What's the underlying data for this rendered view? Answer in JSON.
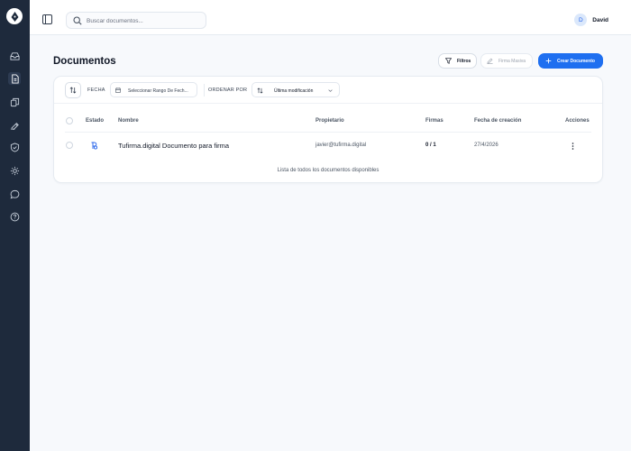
{
  "search": {
    "placeholder": "Buscar documentos..."
  },
  "user": {
    "initial": "D",
    "name": "David"
  },
  "page": {
    "title": "Documentos"
  },
  "actions": {
    "filters": "Filtros",
    "mass_sign": "Firma Masiva",
    "create": "Crear Documento"
  },
  "filters": {
    "date_label": "FECHA",
    "date_placeholder": "Seleccionar Rango De Fech...",
    "order_label": "ORDENAR POR",
    "order_value": "Última modificación"
  },
  "table": {
    "columns": {
      "estado": "Estado",
      "nombre": "Nombre",
      "propietario": "Propietario",
      "firmas": "Firmas",
      "fecha": "Fecha de creación",
      "acciones": "Acciones"
    },
    "rows": [
      {
        "nombre": "Tufirma.digital Documento para firma",
        "propietario": "javier@tufirma.digital",
        "firmas": "0 / 1",
        "fecha": "27/4/2026"
      }
    ],
    "caption": "Lista de todos los documentos disponibles"
  },
  "colors": {
    "sidebar": "#1e2a3c",
    "accent": "#1e6ff0",
    "page_bg": "#f7f9fc"
  }
}
